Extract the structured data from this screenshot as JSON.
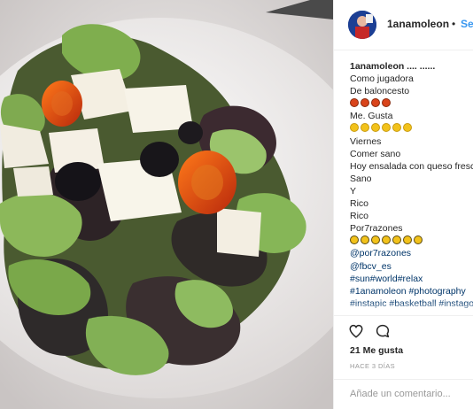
{
  "post": {
    "username": "1anamoleon",
    "follow_label": "Seguir",
    "separator": "•"
  },
  "caption": {
    "first_line": "1anamoleon .... ......",
    "lines": [
      "Como jugadora",
      "De baloncesto"
    ],
    "after_emoji_1": "Me. Gusta",
    "lines2": [
      "Viernes",
      "Comer sano",
      "Hoy ensalada con queso fresco",
      "Sano",
      "Y",
      "Rico",
      "Rico",
      "Por7razones"
    ],
    "links": [
      "@por7razones",
      "@fbcv_es",
      "#sun#world#relax",
      "#1anamoleon #photography",
      "#instapic #basketball #instagood"
    ],
    "basketball_emoji_count": 4,
    "smile_emoji_count": 6,
    "bee_emoji_count": 7
  },
  "actions": {
    "likes": "21 Me gusta",
    "time": "HACE 3 DÍAS",
    "add_comment_placeholder": "Añade un comentario..."
  },
  "icons": {
    "like": "heart-icon",
    "comment": "comment-icon"
  }
}
